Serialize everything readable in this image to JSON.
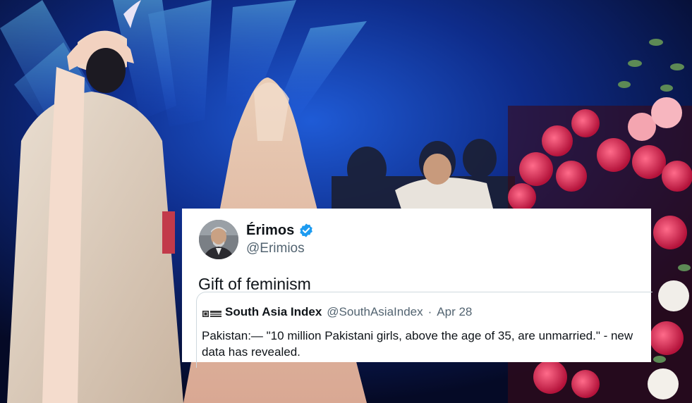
{
  "tweet": {
    "display_name": "Érimos",
    "handle": "@Erimios",
    "text": "Gift of feminism",
    "verified_icon": "verified-badge-icon",
    "avatar_icon": "profile-photo-avatar"
  },
  "quoted_tweet": {
    "logo_icon": "south-asia-index-logo-icon",
    "name": "South Asia Index",
    "handle": "@SouthAsiaIndex",
    "separator": "·",
    "date": "Apr 28",
    "text": "Pakistan:— \"10 million Pakistani girls, above the age of 35, are unmarried.\" - new data has revealed."
  },
  "colors": {
    "card_background": "#ffffff",
    "primary_text": "#0f1419",
    "secondary_text": "#536471",
    "verified_blue": "#1d9bf0",
    "border": "#cfd9de"
  }
}
